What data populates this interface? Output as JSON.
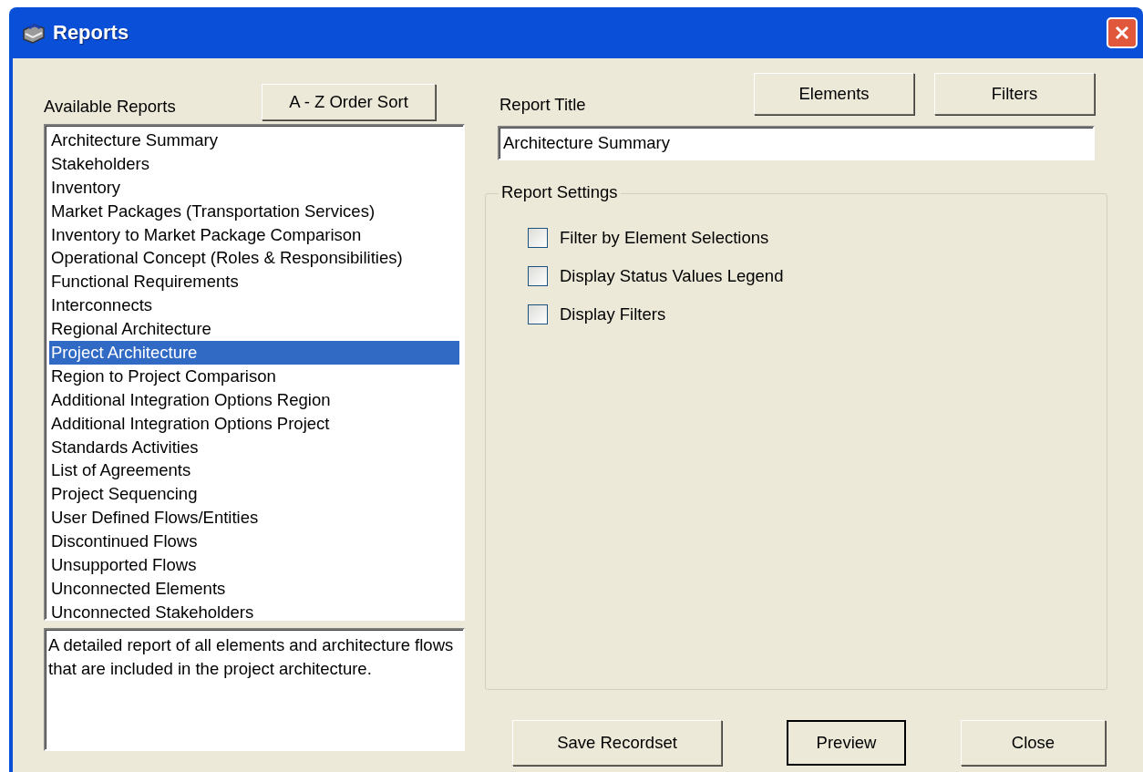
{
  "window": {
    "title": "Reports"
  },
  "available_reports": {
    "label": "Available Reports",
    "sort_button": "A - Z Order Sort",
    "items": [
      {
        "label": "Architecture Summary",
        "selected": false
      },
      {
        "label": "Stakeholders",
        "selected": false
      },
      {
        "label": "Inventory",
        "selected": false
      },
      {
        "label": "Market Packages (Transportation Services)",
        "selected": false
      },
      {
        "label": "Inventory to Market Package Comparison",
        "selected": false
      },
      {
        "label": "Operational Concept (Roles & Responsibilities)",
        "selected": false
      },
      {
        "label": "Functional Requirements",
        "selected": false
      },
      {
        "label": "Interconnects",
        "selected": false
      },
      {
        "label": "Regional Architecture",
        "selected": false
      },
      {
        "label": "Project Architecture",
        "selected": true
      },
      {
        "label": "Region to Project Comparison",
        "selected": false
      },
      {
        "label": "Additional Integration Options Region",
        "selected": false
      },
      {
        "label": "Additional Integration Options Project",
        "selected": false
      },
      {
        "label": "Standards Activities",
        "selected": false
      },
      {
        "label": "List of Agreements",
        "selected": false
      },
      {
        "label": "Project Sequencing",
        "selected": false
      },
      {
        "label": "User Defined Flows/Entities",
        "selected": false
      },
      {
        "label": "Discontinued Flows",
        "selected": false
      },
      {
        "label": "Unsupported Flows",
        "selected": false
      },
      {
        "label": "Unconnected Elements",
        "selected": false
      },
      {
        "label": "Unconnected Stakeholders",
        "selected": false
      }
    ],
    "description": "A detailed report of all elements and architecture flows that are included in the project architecture."
  },
  "top_buttons": [
    {
      "label": "Elements"
    },
    {
      "label": "Filters"
    }
  ],
  "report_title": {
    "label": "Report Title",
    "value": "Architecture Summary"
  },
  "report_settings": {
    "label": "Report Settings",
    "options": [
      {
        "label": "Filter by Element Selections",
        "checked": false
      },
      {
        "label": "Display Status Values Legend",
        "checked": false
      },
      {
        "label": "Display Filters",
        "checked": false
      }
    ]
  },
  "bottom_buttons": [
    {
      "label": "Save Recordset",
      "default": false
    },
    {
      "label": "Preview",
      "default": true
    },
    {
      "label": "Close",
      "default": false
    }
  ]
}
